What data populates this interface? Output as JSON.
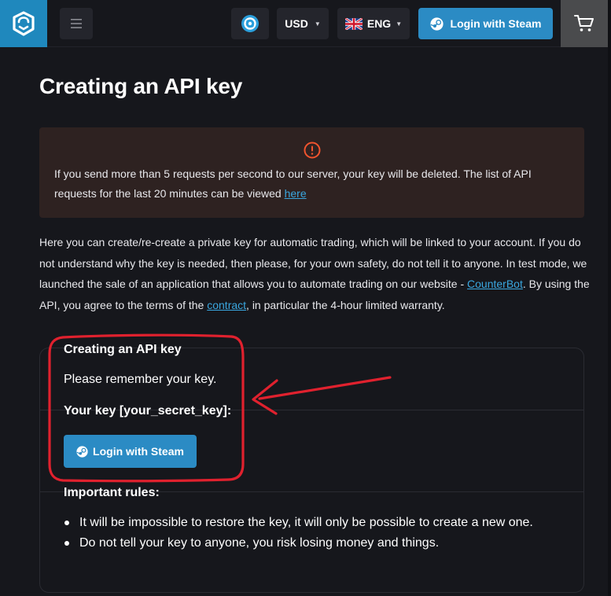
{
  "header": {
    "currency": "USD",
    "language": "ENG",
    "login_label": "Login with Steam",
    "icons": {
      "logo": "brand-logo-icon",
      "menu": "hamburger-menu-icon",
      "coin": "coin-icon",
      "flag": "uk-flag-icon",
      "steam": "steam-icon",
      "cart": "cart-icon"
    }
  },
  "main": {
    "title": "Creating an API key",
    "alert": {
      "text": "If you send more than 5 requests per second to our server, your key will be deleted. The list of API requests for the last 20 minutes can be viewed ",
      "link": "here",
      "icon": "warning-circle-icon",
      "color": "#f0542e"
    },
    "intro": {
      "part1": "Here you can create/re-create a private key for automatic trading, which will be linked to your account. If you do not understand why the key is needed, then please, for your own safety, do not tell it to anyone. In test mode, we launched the sale of an application that allows you to automate trading on our website - ",
      "link1": "CounterBot",
      "part2": ". By using the API, you agree to the terms of the ",
      "link2": "contract",
      "part3": ", in particular the 4-hour limited warranty."
    },
    "card": {
      "title": "Creating an API key",
      "remember": "Please remember your key.",
      "your_key": "Your key [your_secret_key]:",
      "login_label": "Login with Steam",
      "rules_title": "Important rules:",
      "rules": [
        "It will be impossible to restore the key, it will only be possible to create a new one.",
        "Do not tell your key to anyone, you risk losing money and things."
      ]
    }
  },
  "colors": {
    "accent": "#2b8bc4",
    "background": "#16171c",
    "annotation": "#e0212e",
    "link": "#3aa7e0"
  }
}
